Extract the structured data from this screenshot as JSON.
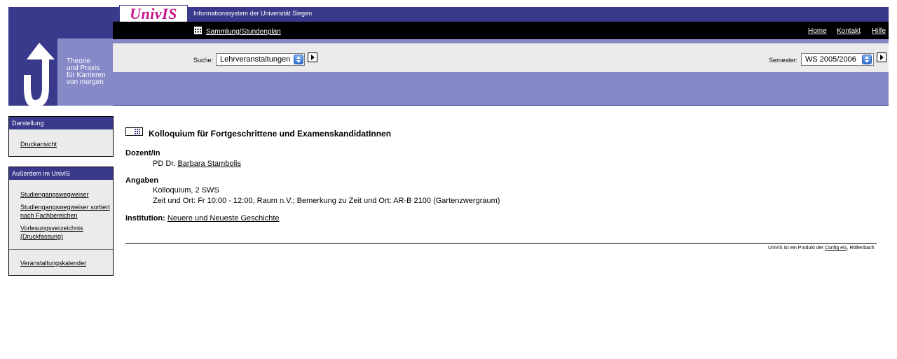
{
  "header": {
    "logo_text": "UnivIS",
    "tagline": "Informationssystem der Universität Siegen",
    "slogan": "Theorie\nund Praxis\nfür Karrieren\nvon morgen",
    "breadcrumb": "Sammlung/Stundenplan",
    "links": {
      "home": "Home",
      "contact": "Kontakt",
      "help": "Hilfe"
    }
  },
  "search": {
    "label": "Suche:",
    "selected": "Lehrveranstaltungen",
    "semester_label": "Semester:",
    "semester_selected": "WS 2005/2006"
  },
  "sidebar": {
    "darstellung": {
      "title": "Darstellung",
      "items": [
        "Druckansicht"
      ]
    },
    "ausserdem": {
      "title": "Außerdem im UnivIS",
      "items": [
        "Studiengangswegweiser",
        "Studiengangswegweiser sortiert nach Fachbereichen",
        "Vorlesungsverzeichnis (Druckfassung)",
        "Veranstaltungskalender"
      ]
    }
  },
  "course": {
    "title": "Kolloquium für Fortgeschrittene und ExamenskandidatInnen",
    "lecturer_heading": "Dozent/in",
    "lecturer_prefix": "PD Dr.",
    "lecturer_name": "Barbara Stambolis",
    "details_heading": "Angaben",
    "details_line1": "Kolloquium, 2 SWS",
    "details_line2": "Zeit und Ort: Fr 10:00 - 12:00, Raum n.V.; Bemerkung zu Zeit und Ort: AR-B 2100 (Gartenzwergraum)",
    "institution_label": "Institution:",
    "institution_name": "Neuere und Neueste Geschichte"
  },
  "footer": {
    "text_before": "UnivIS ist ein Produkt der",
    "company": "Config eG",
    "text_after": ", Röllenbach"
  }
}
